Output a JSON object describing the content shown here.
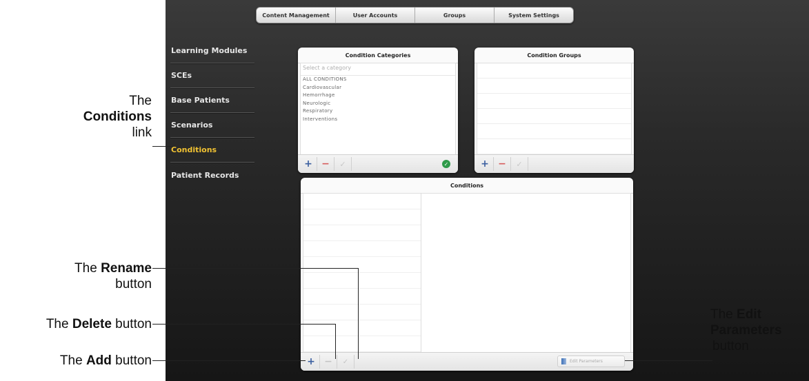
{
  "top_nav": {
    "tabs": [
      "Content Management",
      "User Accounts",
      "Groups",
      "System Settings"
    ]
  },
  "side_nav": {
    "items": [
      "Learning Modules",
      "SCEs",
      "Base Patients",
      "Scenarios",
      "Conditions",
      "Patient Records"
    ],
    "active": "Conditions",
    "active_color": "#f1c232"
  },
  "condition_categories": {
    "title": "Condition Categories",
    "placeholder": "Select a category",
    "items": [
      "ALL CONDITIONS",
      "Cardiovascular",
      "Hemorrhage",
      "Neurologic",
      "Respiratory",
      "Interventions"
    ]
  },
  "condition_groups": {
    "title": "Condition Groups"
  },
  "conditions": {
    "title": "Conditions",
    "edit_parameters_label": "Edit Parameters"
  },
  "toolbar": {
    "add_symbol": "+",
    "delete_symbol": "−",
    "rename_symbol": "✓",
    "ok_symbol": "✓"
  },
  "callouts": {
    "conditions": {
      "prefix": "The",
      "bold": "Conditions",
      "suffix": "link"
    },
    "rename": {
      "prefix": "The",
      "bold": "Rename",
      "suffix": "button"
    },
    "delete": {
      "prefix": "The",
      "bold": "Delete",
      "suffix": "button"
    },
    "add": {
      "prefix": "The",
      "bold": "Add",
      "suffix": "button"
    },
    "edit": {
      "prefix": "The",
      "bold": "Edit",
      "bold2": "Parameters",
      "suffix": "button"
    }
  }
}
